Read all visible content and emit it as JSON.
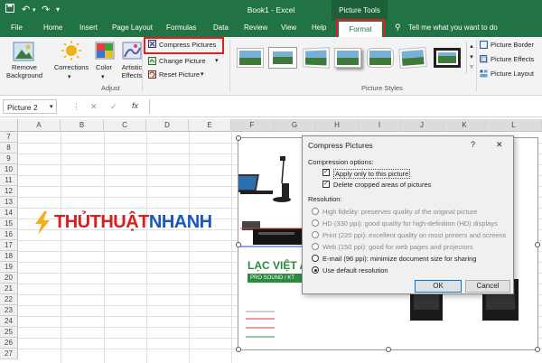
{
  "window": {
    "title": "Book1 - Excel",
    "context_tab_group": "Picture Tools"
  },
  "tabs": [
    {
      "label": "File"
    },
    {
      "label": "Home"
    },
    {
      "label": "Insert"
    },
    {
      "label": "Page Layout"
    },
    {
      "label": "Formulas"
    },
    {
      "label": "Data"
    },
    {
      "label": "Review"
    },
    {
      "label": "View"
    },
    {
      "label": "Help"
    }
  ],
  "active_tab": "Format",
  "tell_me": "Tell me what you want to do",
  "ribbon": {
    "remove_background": "Remove\nBackground",
    "corrections": "Corrections",
    "color": "Color",
    "artistic_effects": "Artistic\nEffects",
    "compress_pictures": "Compress Pictures",
    "change_picture": "Change Picture",
    "reset_picture": "Reset Picture",
    "adjust_group": "Adjust",
    "picture_styles_group": "Picture Styles",
    "picture_border": "Picture Border",
    "picture_effects": "Picture Effects",
    "picture_layout": "Picture Layout"
  },
  "formula_bar": {
    "name_box": "Picture 2",
    "fx": "fx"
  },
  "grid": {
    "columns": [
      "A",
      "B",
      "C",
      "D",
      "E",
      "F",
      "G",
      "H",
      "I",
      "J",
      "K",
      "L"
    ],
    "rows": [
      "7",
      "8",
      "9",
      "10",
      "11",
      "12",
      "13",
      "14",
      "15",
      "16",
      "17",
      "18",
      "19",
      "20",
      "21",
      "22",
      "23",
      "24",
      "25",
      "26",
      "27"
    ]
  },
  "picture": {
    "brand": "LẠC VIỆT A",
    "subtitle": "PRO SOUND / KT"
  },
  "logo_text": "THỦTHUẬTNHANH",
  "dialog": {
    "title": "Compress Pictures",
    "help": "?",
    "close": "✕",
    "compression_options_label": "Compression options:",
    "apply_only": "Apply only to this picture",
    "delete_cropped": "Delete cropped areas of pictures",
    "resolution_label": "Resolution:",
    "options": [
      {
        "label": "High fidelity: preserves quality of the original picture",
        "enabled": false,
        "selected": false
      },
      {
        "label": "HD (330 ppi): good quality for high-definition (HD) displays",
        "enabled": false,
        "selected": false
      },
      {
        "label": "Print (220 ppi): excellent quality on most printers and screens",
        "enabled": false,
        "selected": false
      },
      {
        "label": "Web (150 ppi): good for web pages and projectors",
        "enabled": false,
        "selected": false
      },
      {
        "label": "E-mail (96 ppi): minimize document size for sharing",
        "enabled": true,
        "selected": false
      },
      {
        "label": "Use default resolution",
        "enabled": true,
        "selected": true
      }
    ],
    "ok": "OK",
    "cancel": "Cancel"
  },
  "colors": {
    "excel_green": "#217346",
    "highlight_red": "#e02020",
    "logo_blue": "#1a57b8",
    "logo_red": "#d42020",
    "brand_green": "#2b8a3e"
  }
}
